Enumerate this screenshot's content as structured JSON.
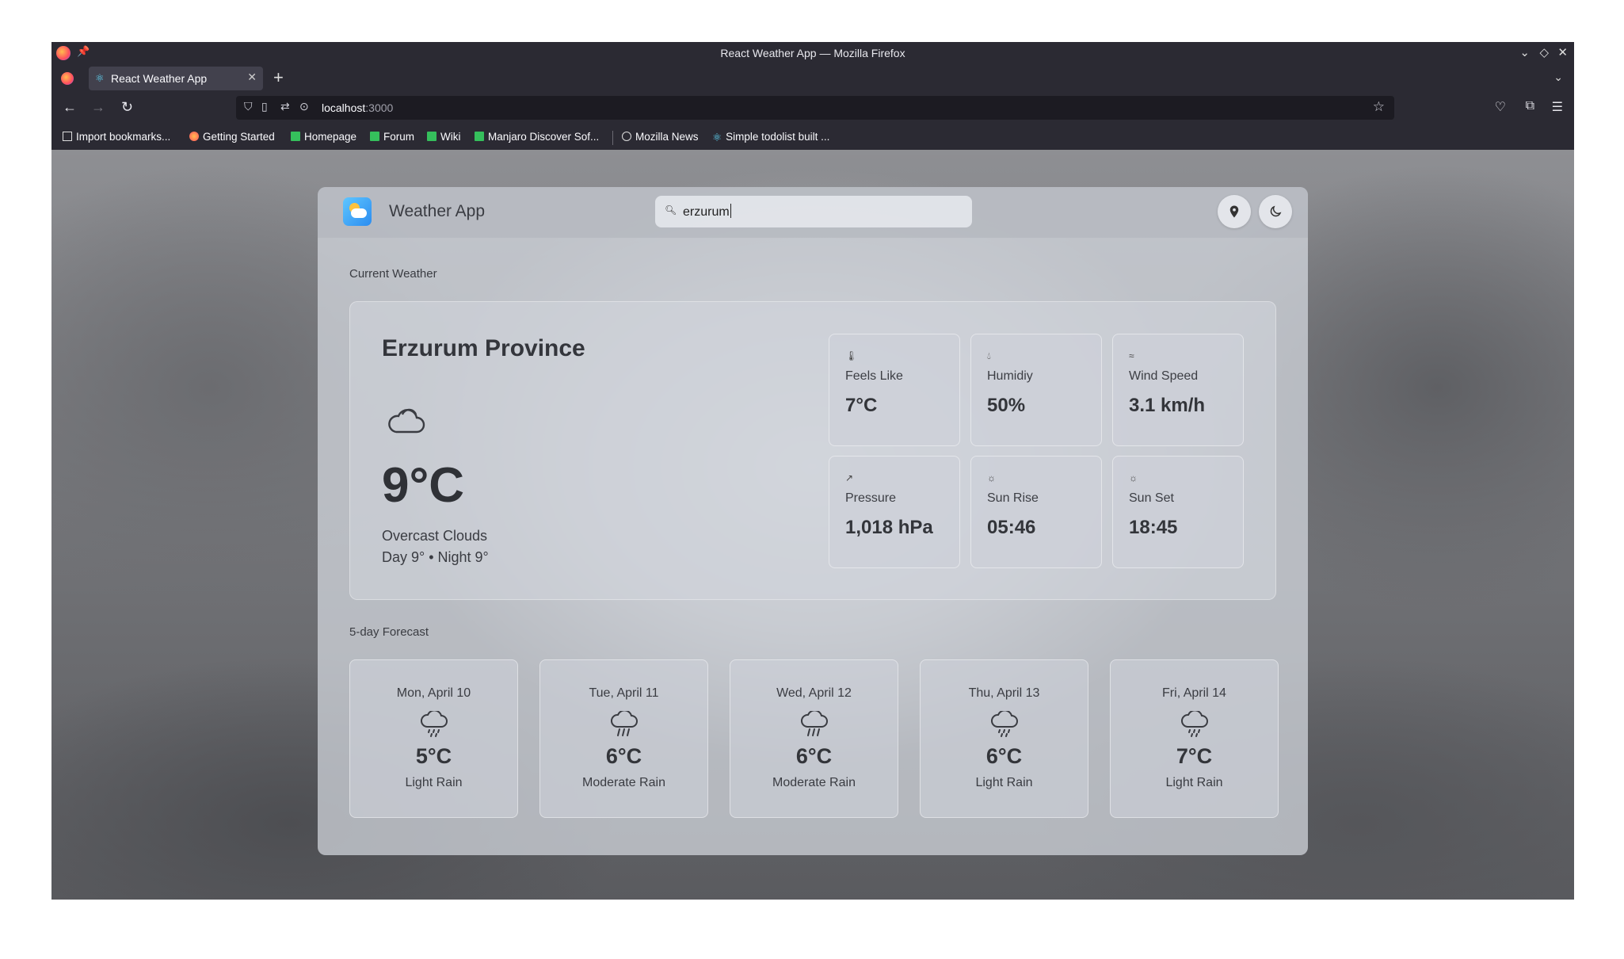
{
  "browser": {
    "window_title": "React Weather App — Mozilla Firefox",
    "tab_title": "React Weather App",
    "url_host": "localhost",
    "url_port": ":3000",
    "bookmarks": [
      {
        "label": "Import bookmarks...",
        "icon": "import-icon"
      },
      {
        "label": "Getting Started",
        "icon": "firefox-icon"
      },
      {
        "label": "Homepage",
        "icon": "manjaro-icon"
      },
      {
        "label": "Forum",
        "icon": "manjaro-icon"
      },
      {
        "label": "Wiki",
        "icon": "manjaro-icon"
      },
      {
        "label": "Manjaro Discover Sof...",
        "icon": "manjaro-icon"
      },
      {
        "label": "Mozilla News",
        "icon": "globe-icon"
      },
      {
        "label": "Simple todolist built ...",
        "icon": "react-icon"
      }
    ]
  },
  "app": {
    "title": "Weather App",
    "search_value": "erzurum",
    "current_label": "Current Weather",
    "forecast_label": "5-day Forecast",
    "current": {
      "city": "Erzurum Province",
      "icon": "cloud-icon",
      "temp": "9°C",
      "description": "Overcast Clouds",
      "day_night": "Day 9° • Night 9°",
      "stats": [
        {
          "label": "Feels Like",
          "value": "7°C",
          "icon": "thermometer-icon"
        },
        {
          "label": "Humidiy",
          "value": "50%",
          "icon": "droplet-icon"
        },
        {
          "label": "Wind Speed",
          "value": "3.1 km/h",
          "icon": "wind-icon"
        },
        {
          "label": "Pressure",
          "value": "1,018 hPa",
          "icon": "pressure-icon"
        },
        {
          "label": "Sun Rise",
          "value": "05:46",
          "icon": "sunrise-icon"
        },
        {
          "label": "Sun Set",
          "value": "18:45",
          "icon": "sunset-icon"
        }
      ]
    },
    "forecast": [
      {
        "date": "Mon, April 10",
        "temp": "5°C",
        "description": "Light Rain",
        "icon": "light-rain-icon"
      },
      {
        "date": "Tue, April 11",
        "temp": "6°C",
        "description": "Moderate Rain",
        "icon": "moderate-rain-icon"
      },
      {
        "date": "Wed, April 12",
        "temp": "6°C",
        "description": "Moderate Rain",
        "icon": "moderate-rain-icon"
      },
      {
        "date": "Thu, April 13",
        "temp": "6°C",
        "description": "Light Rain",
        "icon": "light-rain-icon"
      },
      {
        "date": "Fri, April 14",
        "temp": "7°C",
        "description": "Light Rain",
        "icon": "light-rain-icon"
      }
    ]
  }
}
